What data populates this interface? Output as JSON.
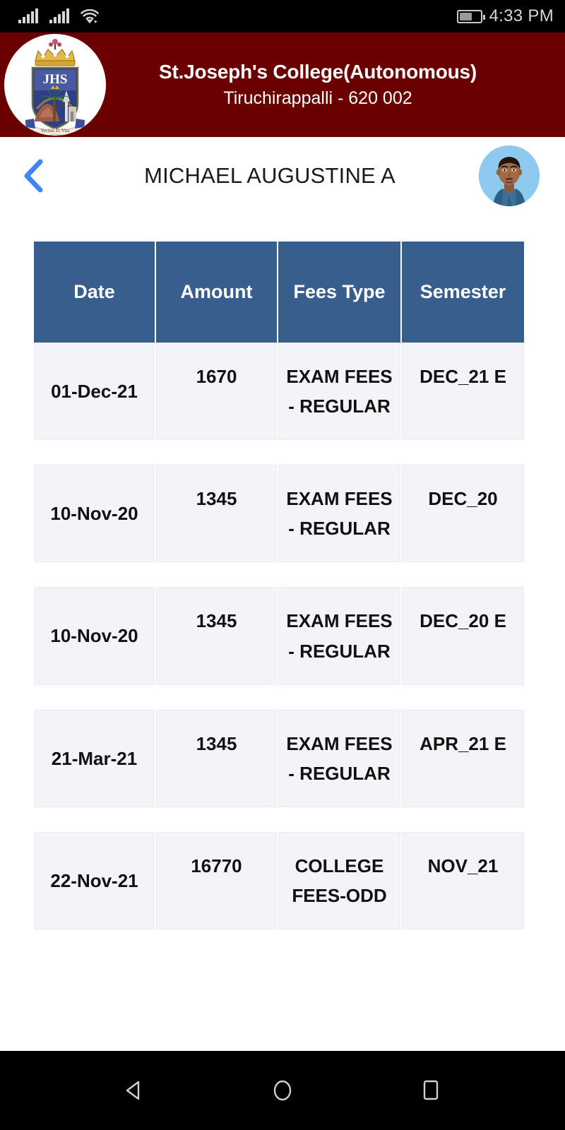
{
  "status_bar": {
    "signal_icon_1": "cellular-signal-icon",
    "signal_icon_2": "cellular-signal-icon",
    "wifi_icon": "wifi-icon",
    "battery_icon": "battery-icon",
    "battery_level_percent": 62,
    "time": "4:33 PM"
  },
  "college_header": {
    "logo_icon": "college-crest-logo",
    "logo_motto": "JHS",
    "name": "St.Joseph's College(Autonomous)",
    "city": "Tiruchirappalli - 620 002",
    "background_color": "#6b0000"
  },
  "nav_bar": {
    "back_icon": "chevron-left-icon",
    "back_icon_color": "#4285f4",
    "title": "MICHAEL AUGUSTINE A",
    "avatar_icon": "student-avatar"
  },
  "table": {
    "header_color": "#375e8c",
    "row_color": "#f2f4f7",
    "columns": [
      {
        "key": "date",
        "label": "Date"
      },
      {
        "key": "amount",
        "label": "Amount"
      },
      {
        "key": "fees_type",
        "label": "Fees Type"
      },
      {
        "key": "semester",
        "label": "Semester"
      }
    ],
    "rows": [
      {
        "date": "01-Dec-21",
        "amount": "1670",
        "fees_type": "EXAM FEES - REGULAR",
        "semester": "DEC_21 E"
      },
      {
        "date": "10-Nov-20",
        "amount": "1345",
        "fees_type": "EXAM FEES - REGULAR",
        "semester": "DEC_20"
      },
      {
        "date": "10-Nov-20",
        "amount": "1345",
        "fees_type": "EXAM FEES - REGULAR",
        "semester": "DEC_20 E"
      },
      {
        "date": "21-Mar-21",
        "amount": "1345",
        "fees_type": "EXAM FEES - REGULAR",
        "semester": "APR_21 E"
      },
      {
        "date": "22-Nov-21",
        "amount": "16770",
        "fees_type": "COLLEGE FEES-ODD",
        "semester": "NOV_21"
      }
    ]
  },
  "android_nav": {
    "back_icon": "triangle-back-icon",
    "home_icon": "circle-home-icon",
    "recents_icon": "square-recents-icon"
  }
}
